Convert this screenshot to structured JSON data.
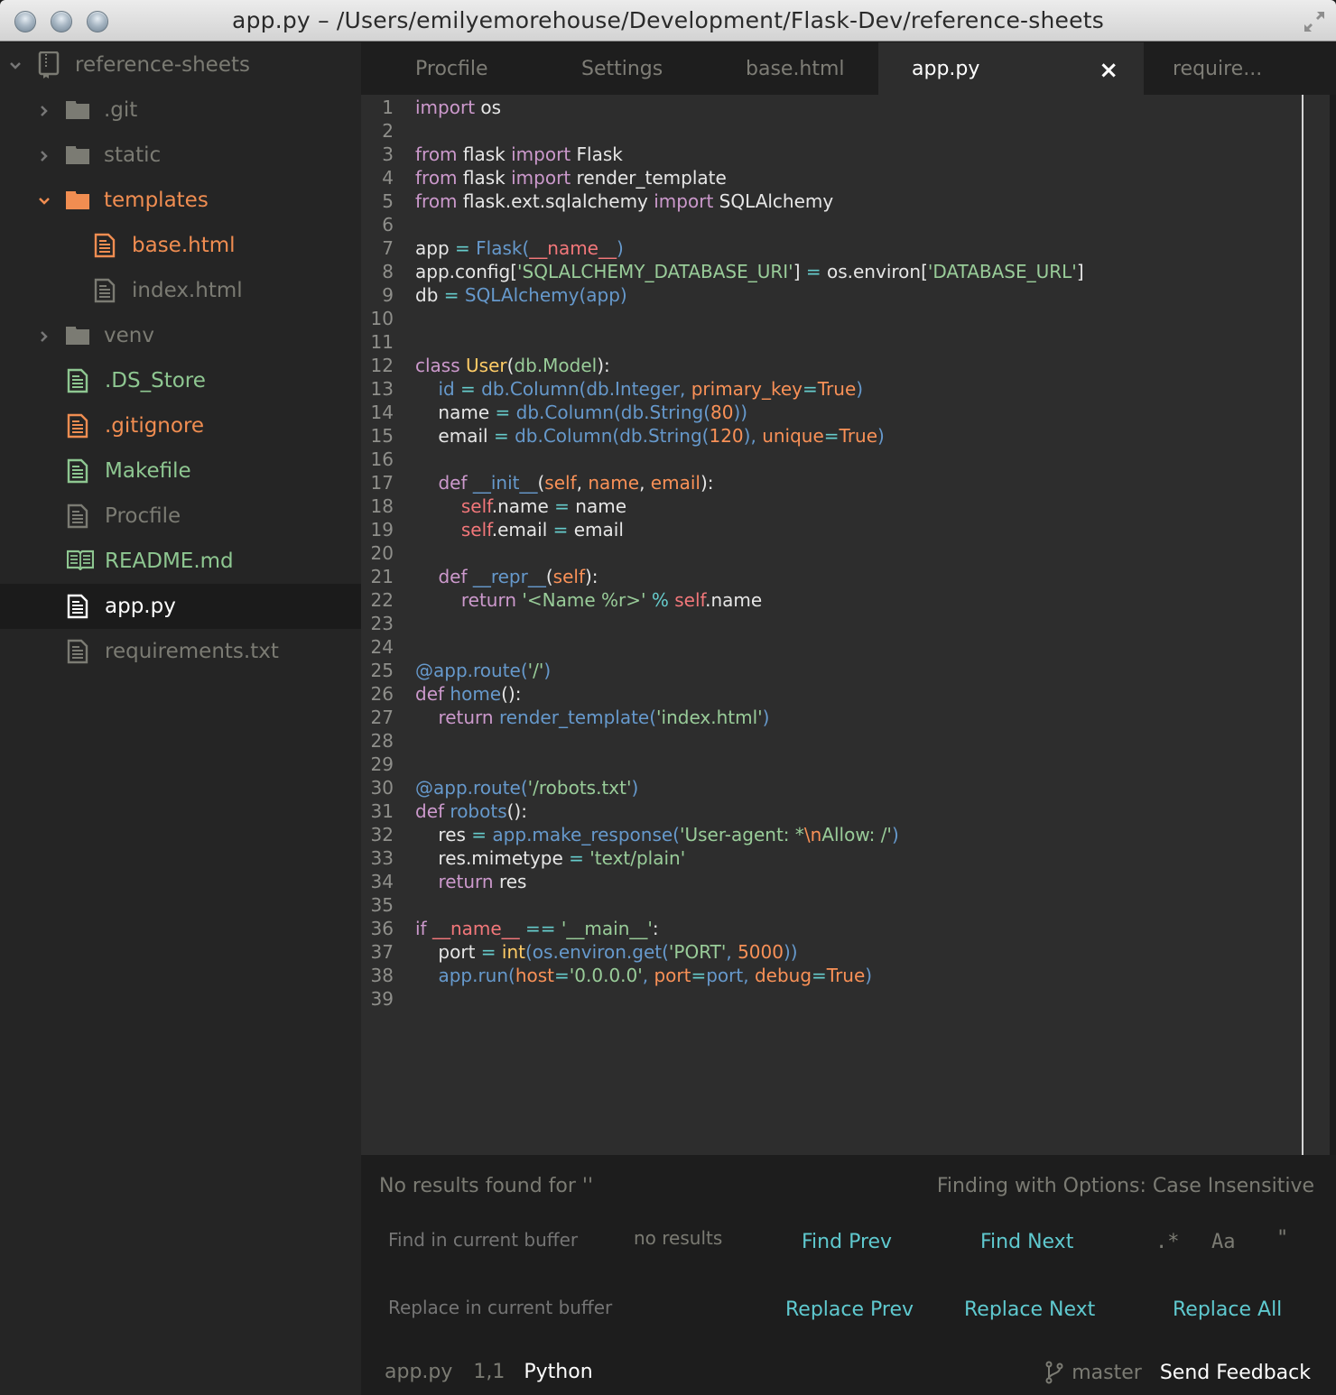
{
  "window": {
    "title": "app.py – /Users/emilyemorehouse/Development/Flask-Dev/reference-sheets"
  },
  "sidebar": {
    "project": {
      "label": "reference-sheets",
      "icon": "repo-icon",
      "expanded": true
    },
    "items": [
      {
        "label": ".git",
        "type": "folder",
        "expanded": false,
        "color": "#7b7b73"
      },
      {
        "label": "static",
        "type": "folder",
        "expanded": false,
        "color": "#7b7b73"
      },
      {
        "label": "templates",
        "type": "folder",
        "expanded": true,
        "color": "#f08d51"
      },
      {
        "label": "base.html",
        "type": "file",
        "color": "#f08d51"
      },
      {
        "label": "index.html",
        "type": "file",
        "color": "#7b7b73"
      },
      {
        "label": "venv",
        "type": "folder",
        "expanded": false,
        "color": "#7b7b73"
      },
      {
        "label": ".DS_Store",
        "type": "file",
        "color": "#8ec791"
      },
      {
        "label": ".gitignore",
        "type": "file",
        "color": "#f08d51"
      },
      {
        "label": "Makefile",
        "type": "file",
        "color": "#8ec791"
      },
      {
        "label": "Procfile",
        "type": "file",
        "color": "#7b7b73"
      },
      {
        "label": "README.md",
        "type": "book",
        "color": "#8ec791"
      },
      {
        "label": "app.py",
        "type": "file",
        "color": "#ffffff",
        "selected": true
      },
      {
        "label": "requirements.txt",
        "type": "file",
        "color": "#7b7b73"
      }
    ]
  },
  "tabs": [
    {
      "label": "Procfile",
      "active": false
    },
    {
      "label": "Settings",
      "active": false
    },
    {
      "label": "base.html",
      "active": false
    },
    {
      "label": "app.py",
      "active": true,
      "close_icon": "×"
    },
    {
      "label": "require...",
      "active": false
    }
  ],
  "editor": {
    "lines": [
      [
        [
          "k",
          "import"
        ],
        [
          "w",
          " os"
        ]
      ],
      [],
      [
        [
          "k",
          "from"
        ],
        [
          "w",
          " flask "
        ],
        [
          "k",
          "import"
        ],
        [
          "w",
          " Flask"
        ]
      ],
      [
        [
          "k",
          "from"
        ],
        [
          "w",
          " flask "
        ],
        [
          "k",
          "import"
        ],
        [
          "w",
          " render_template"
        ]
      ],
      [
        [
          "k",
          "from"
        ],
        [
          "w",
          " flask.ext.sqlalchemy "
        ],
        [
          "k",
          "import"
        ],
        [
          "w",
          " SQLAlchemy"
        ]
      ],
      [],
      [
        [
          "w",
          "app "
        ],
        [
          "o",
          "="
        ],
        [
          "f",
          " Flask("
        ],
        [
          "r",
          "__name__"
        ],
        [
          "f",
          ")"
        ]
      ],
      [
        [
          "w",
          "app.config["
        ],
        [
          "s",
          "'SQLALCHEMY_DATABASE_URI'"
        ],
        [
          "w",
          "] "
        ],
        [
          "o",
          "="
        ],
        [
          "w",
          " os.environ["
        ],
        [
          "s",
          "'DATABASE_URL'"
        ],
        [
          "w",
          "]"
        ]
      ],
      [
        [
          "w",
          "db "
        ],
        [
          "o",
          "="
        ],
        [
          "f",
          " SQLAlchemy(app)"
        ]
      ],
      [],
      [],
      [
        [
          "k",
          "class"
        ],
        [
          "y",
          " User"
        ],
        [
          "w",
          "("
        ],
        [
          "s",
          "db.Model"
        ],
        [
          "w",
          "):"
        ]
      ],
      [
        [
          "w",
          "    "
        ],
        [
          "f",
          "id "
        ],
        [
          "o",
          "="
        ],
        [
          "f",
          " db.Column(db.Integer, "
        ],
        [
          "p",
          "primary_key"
        ],
        [
          "o",
          "="
        ],
        [
          "p",
          "True"
        ],
        [
          "f",
          ")"
        ]
      ],
      [
        [
          "w",
          "    name "
        ],
        [
          "o",
          "="
        ],
        [
          "f",
          " db.Column(db.String("
        ],
        [
          "p",
          "80"
        ],
        [
          "f",
          "))"
        ]
      ],
      [
        [
          "w",
          "    email "
        ],
        [
          "o",
          "="
        ],
        [
          "f",
          " db.Column(db.String("
        ],
        [
          "p",
          "120"
        ],
        [
          "f",
          "), "
        ],
        [
          "p",
          "unique"
        ],
        [
          "o",
          "="
        ],
        [
          "p",
          "True"
        ],
        [
          "f",
          ")"
        ]
      ],
      [],
      [
        [
          "w",
          "    "
        ],
        [
          "k",
          "def"
        ],
        [
          "f",
          " __init__"
        ],
        [
          "w",
          "("
        ],
        [
          "p",
          "self"
        ],
        [
          "w",
          ", "
        ],
        [
          "p",
          "name"
        ],
        [
          "w",
          ", "
        ],
        [
          "p",
          "email"
        ],
        [
          "w",
          "):"
        ]
      ],
      [
        [
          "w",
          "        "
        ],
        [
          "r",
          "self"
        ],
        [
          "w",
          ".name "
        ],
        [
          "o",
          "="
        ],
        [
          "w",
          " name"
        ]
      ],
      [
        [
          "w",
          "        "
        ],
        [
          "r",
          "self"
        ],
        [
          "w",
          ".email "
        ],
        [
          "o",
          "="
        ],
        [
          "w",
          " email"
        ]
      ],
      [],
      [
        [
          "w",
          "    "
        ],
        [
          "k",
          "def"
        ],
        [
          "f",
          " __repr__"
        ],
        [
          "w",
          "("
        ],
        [
          "p",
          "self"
        ],
        [
          "w",
          "):"
        ]
      ],
      [
        [
          "w",
          "        "
        ],
        [
          "k",
          "return"
        ],
        [
          "s",
          " '<Name %r>'"
        ],
        [
          "o",
          " %"
        ],
        [
          "r",
          " self"
        ],
        [
          "w",
          ".name"
        ]
      ],
      [],
      [],
      [
        [
          "f",
          "@app.route("
        ],
        [
          "s",
          "'/'"
        ],
        [
          "f",
          ")"
        ]
      ],
      [
        [
          "k",
          "def"
        ],
        [
          "f",
          " home"
        ],
        [
          "w",
          "():"
        ]
      ],
      [
        [
          "w",
          "    "
        ],
        [
          "k",
          "return"
        ],
        [
          "f",
          " render_template("
        ],
        [
          "s",
          "'index.html'"
        ],
        [
          "f",
          ")"
        ]
      ],
      [],
      [],
      [
        [
          "f",
          "@app.route("
        ],
        [
          "s",
          "'/robots.txt'"
        ],
        [
          "f",
          ")"
        ]
      ],
      [
        [
          "k",
          "def"
        ],
        [
          "f",
          " robots"
        ],
        [
          "w",
          "():"
        ]
      ],
      [
        [
          "w",
          "    res "
        ],
        [
          "o",
          "="
        ],
        [
          "f",
          " app.make_response("
        ],
        [
          "s",
          "'User-agent: *"
        ],
        [
          "p",
          "\\n"
        ],
        [
          "s",
          "Allow: /'"
        ],
        [
          "f",
          ")"
        ]
      ],
      [
        [
          "w",
          "    res.mimetype "
        ],
        [
          "o",
          "="
        ],
        [
          "s",
          " 'text/plain'"
        ]
      ],
      [
        [
          "w",
          "    "
        ],
        [
          "k",
          "return"
        ],
        [
          "w",
          " res"
        ]
      ],
      [],
      [
        [
          "k",
          "if"
        ],
        [
          "r",
          " __name__"
        ],
        [
          "o",
          " =="
        ],
        [
          "s",
          " '__main__'"
        ],
        [
          "w",
          ":"
        ]
      ],
      [
        [
          "w",
          "    port "
        ],
        [
          "o",
          "="
        ],
        [
          "y",
          " int"
        ],
        [
          "f",
          "(os.environ.get("
        ],
        [
          "s",
          "'PORT'"
        ],
        [
          "f",
          ", "
        ],
        [
          "p",
          "5000"
        ],
        [
          "f",
          "))"
        ]
      ],
      [
        [
          "w",
          "    "
        ],
        [
          "f",
          "app.run("
        ],
        [
          "p",
          "host"
        ],
        [
          "o",
          "="
        ],
        [
          "s",
          "'0.0.0.0'"
        ],
        [
          "f",
          ", "
        ],
        [
          "p",
          "port"
        ],
        [
          "o",
          "="
        ],
        [
          "f",
          "port, "
        ],
        [
          "p",
          "debug"
        ],
        [
          "o",
          "="
        ],
        [
          "p",
          "True"
        ],
        [
          "f",
          ")"
        ]
      ],
      []
    ]
  },
  "find": {
    "status": "No results found for ''",
    "options_text": "Finding with Options: Case Insensitive",
    "find_placeholder": "Find in current buffer",
    "find_value": "",
    "result_count": "no results",
    "replace_placeholder": "Replace in current buffer",
    "replace_value": "",
    "buttons": {
      "find_prev": "Find Prev",
      "find_next": "Find Next",
      "replace_prev": "Replace Prev",
      "replace_next": "Replace Next",
      "replace_all": "Replace All"
    },
    "toggles": {
      "regex": ".*",
      "case": "Aa",
      "selection": "\""
    }
  },
  "status": {
    "file": "app.py",
    "cursor": "1,1",
    "grammar": "Python",
    "branch": "master",
    "feedback": "Send Feedback"
  },
  "colors": {
    "accent": "#5fc9cf",
    "modified": "#f08d51",
    "added": "#8ec791",
    "muted": "#7b7b73"
  }
}
